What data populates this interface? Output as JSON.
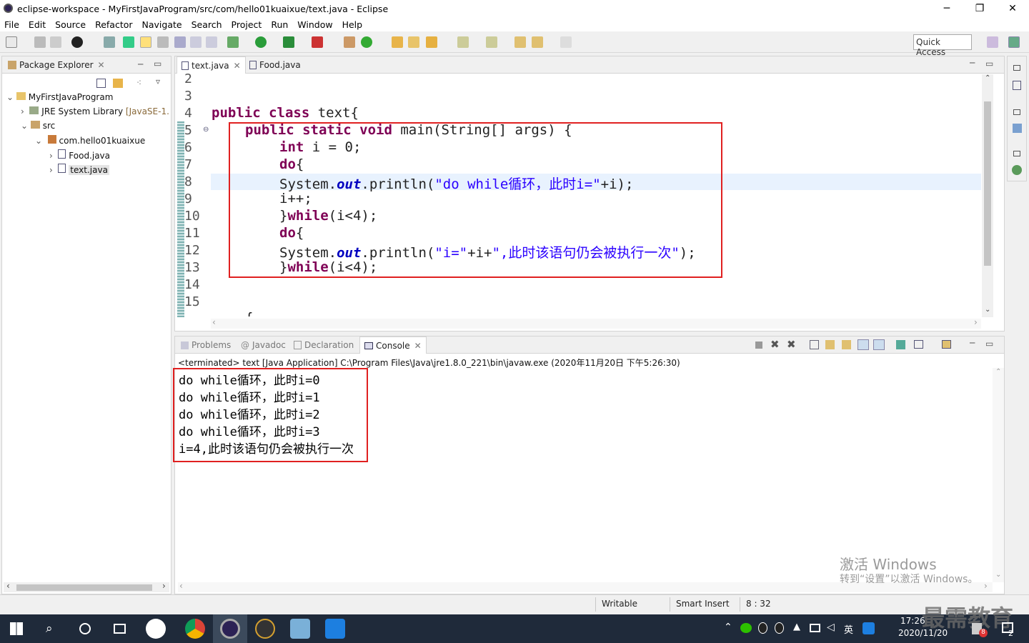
{
  "window": {
    "title": "eclipse-workspace - MyFirstJavaProgram/src/com/hello01kuaixue/text.java - Eclipse",
    "min": "─",
    "max": "❐",
    "close": "✕"
  },
  "menu": [
    "File",
    "Edit",
    "Source",
    "Refactor",
    "Navigate",
    "Search",
    "Project",
    "Run",
    "Window",
    "Help"
  ],
  "quick_access": "Quick Access",
  "explorer": {
    "title": "Package Explorer",
    "items": [
      {
        "label": "MyFirstJavaProgram",
        "extra": ""
      },
      {
        "label": "JRE System Library",
        "extra": "[JavaSE-1."
      },
      {
        "label": "src",
        "extra": ""
      },
      {
        "label": "com.hello01kuaixue",
        "extra": ""
      },
      {
        "label": "Food.java",
        "extra": ""
      },
      {
        "label": "text.java",
        "extra": ""
      }
    ]
  },
  "editor": {
    "tabs": [
      "text.java",
      "Food.java"
    ],
    "line_numbers": [
      "2",
      "3",
      "4",
      "5",
      "6",
      "7",
      "8",
      "9",
      "10",
      "11",
      "12",
      "13",
      "14",
      "15"
    ],
    "lines": [
      {
        "a": "public class ",
        "b": "text{"
      },
      {
        "a": "public static void ",
        "b": "main(String[] args) {"
      },
      {
        "a": "int ",
        "b": "i = 0;"
      },
      {
        "a": "do",
        "b": "{"
      },
      {
        "a": "System.",
        "f": "out",
        "b": ".println(",
        "s": "\"do while循环，此时i=\"",
        "c": "+i);"
      },
      {
        "a": "i++;"
      },
      {
        "a": "}",
        "k": "while",
        "b": "(i<4);"
      },
      {
        "a": "do",
        "b": "{"
      },
      {
        "a": "System.",
        "f": "out",
        "b": ".println(",
        "s": "\"i=\"",
        "c": "+i+",
        "s2": "\",此时该语句仍会被执行一次\"",
        "d": ");"
      },
      {
        "a": "}",
        "k": "while",
        "b": "(i<4);"
      }
    ]
  },
  "console": {
    "tabs": [
      "Problems",
      "Javadoc",
      "Declaration",
      "Console"
    ],
    "terminated": "<terminated> text [Java Application] C:\\Program Files\\Java\\jre1.8.0_221\\bin\\javaw.exe (2020年11月20日 下午5:26:30)",
    "output": [
      "do while循环，此时i=0",
      "do while循环，此时i=1",
      "do while循环，此时i=2",
      "do while循环，此时i=3",
      "i=4,此时该语句仍会被执行一次"
    ]
  },
  "status": {
    "writable": "Writable",
    "insert": "Smart Insert",
    "pos": "8 : 32"
  },
  "watermark": {
    "line1": "激活 Windows",
    "line2": "转到“设置”以激活 Windows。",
    "brand": "最需教育"
  },
  "taskbar": {
    "time": "17:26",
    "date": "2020/11/20",
    "lang": "英",
    "badge": "8",
    "notif": "2"
  }
}
